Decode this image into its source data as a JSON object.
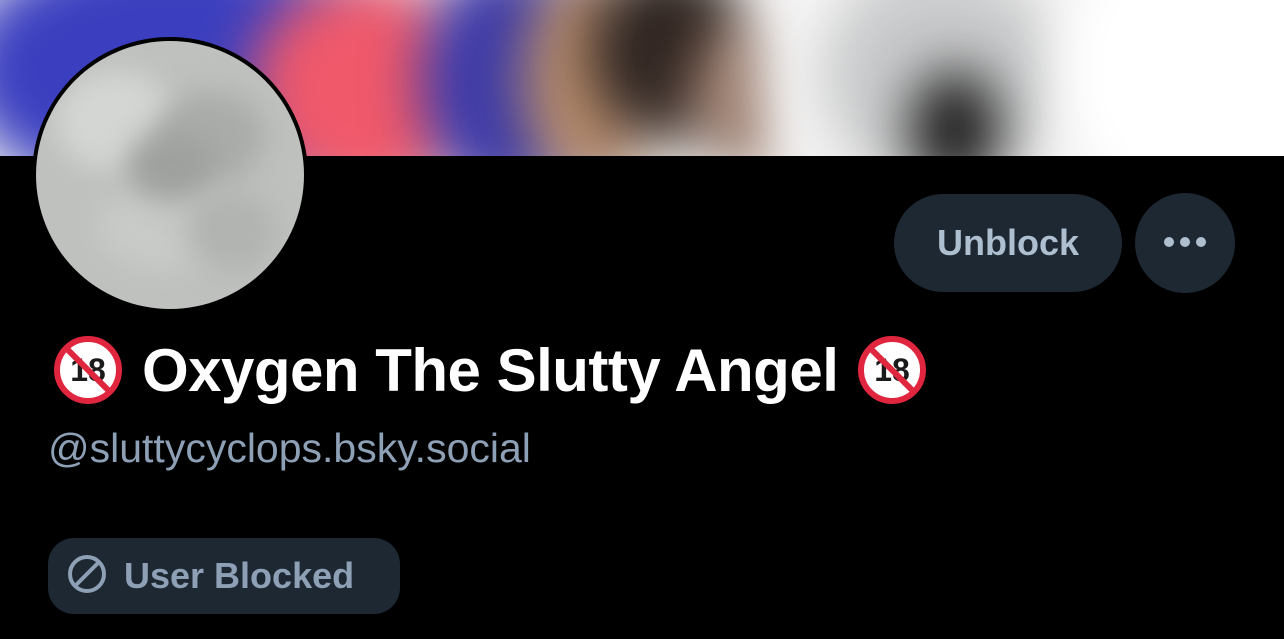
{
  "profile": {
    "display_name": "Oxygen The Slutty Angel",
    "name_prefix_icon": "no-one-under-18-icon",
    "name_suffix_icon": "no-one-under-18-icon",
    "handle": "@sluttycyclops.bsky.social"
  },
  "actions": {
    "unblock_label": "Unblock",
    "more_icon": "ellipsis-icon"
  },
  "status": {
    "blocked_label": "User Blocked",
    "blocked_icon": "block-icon"
  },
  "colors": {
    "background": "#000000",
    "button_bg": "#1e2833",
    "button_text": "#aebfd0",
    "handle_text": "#8da0b6",
    "name_text": "#ffffff",
    "no18_red": "#e0263f"
  }
}
